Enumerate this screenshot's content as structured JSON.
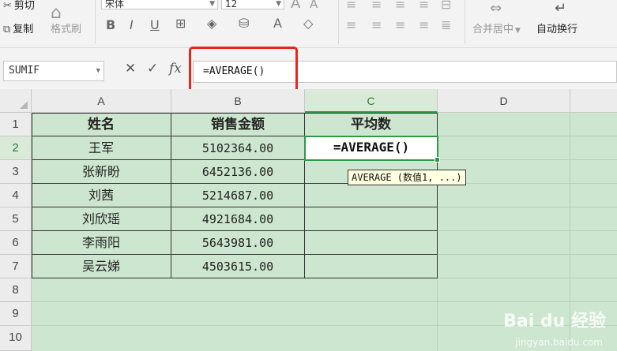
{
  "ribbon": {
    "cut_label": "剪切",
    "copy_label": "复制",
    "format_painter_label": "格式刷",
    "font_name": "宋体",
    "font_size": "12",
    "merge_center_label": "合并居中",
    "wrap_text_label": "自动换行",
    "icons": [
      "cut-icon",
      "copy-icon",
      "format-painter-icon",
      "bold-icon",
      "italic-icon",
      "underline-icon",
      "border-icon",
      "fill-color-icon",
      "font-color-icon",
      "eraser-icon",
      "align-icons",
      "merge-icon",
      "wrap-icon"
    ]
  },
  "formula_bar": {
    "name_box": "SUMIF",
    "cancel_icon": "✕",
    "confirm_icon": "✓",
    "fx_label": "fx",
    "formula": "=AVERAGE()"
  },
  "sheet": {
    "columns": [
      "A",
      "B",
      "C",
      "D"
    ],
    "rows": [
      "1",
      "2",
      "3",
      "4",
      "5",
      "6",
      "7",
      "8",
      "9",
      "10"
    ],
    "selected_column": "C",
    "selected_row": "2",
    "headers": [
      "姓名",
      "销售金额",
      "平均数"
    ],
    "data": [
      {
        "name": "王军",
        "amount": "5102364.00"
      },
      {
        "name": "张新盼",
        "amount": "6452136.00"
      },
      {
        "name": "刘茜",
        "amount": "5214687.00"
      },
      {
        "name": "刘欣瑶",
        "amount": "4921684.00"
      },
      {
        "name": "李雨阳",
        "amount": "5643981.00"
      },
      {
        "name": "吴云娣",
        "amount": "4503615.00"
      }
    ],
    "active_cell_content": "=AVERAGE()",
    "tooltip": "AVERAGE (数值1, ...)"
  },
  "watermark": {
    "brand": "Bai du 经验",
    "url": "jingyan.baidu.com"
  },
  "colors": {
    "sheet_bg": "#cde6cf",
    "selection_green": "#2e9a47",
    "highlight_red": "#e8261b"
  }
}
